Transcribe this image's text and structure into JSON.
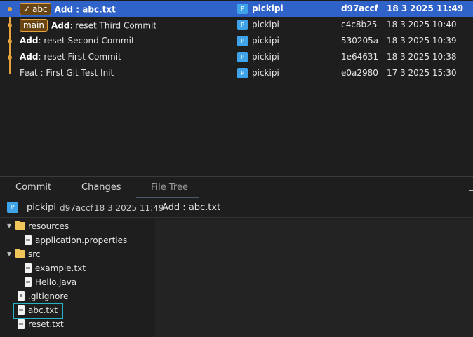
{
  "commits": [
    {
      "tag": "abc",
      "subject_kw": "Add",
      "subject_rest": " : abc.txt",
      "avatar": "P",
      "author": "pickipi",
      "hash": "d97accf",
      "date": "18 3 2025 11:49"
    },
    {
      "tag": "main",
      "subject_kw": "Add",
      "subject_rest": ": reset Third Commit",
      "avatar": "P",
      "author": "pickipi",
      "hash": "c4c8b25",
      "date": "18 3 2025 10:40"
    },
    {
      "subject_kw": "Add",
      "subject_rest": ": reset Second Commit",
      "avatar": "P",
      "author": "pickipi",
      "hash": "530205a",
      "date": "18 3 2025 10:39"
    },
    {
      "subject_kw": "Add",
      "subject_rest": ": reset First Commit",
      "avatar": "P",
      "author": "pickipi",
      "hash": "1e64631",
      "date": "18 3 2025 10:38"
    },
    {
      "subject_kw": "",
      "subject_rest": "Feat : First Git Test Init",
      "avatar": "P",
      "author": "pickipi",
      "hash": "e0a2980",
      "date": "17 3 2025 15:30"
    }
  ],
  "tabs": [
    "Commit",
    "Changes",
    "File Tree"
  ],
  "active_tab": "File Tree",
  "detail": {
    "avatar": "P",
    "author": "pickipi",
    "hash": "d97accf",
    "date": "18 3 2025 11:49",
    "message": "Add : abc.txt"
  },
  "file_tree": [
    {
      "name": "resources",
      "kind": "folder",
      "expanded": true
    },
    {
      "name": "application.properties",
      "kind": "file"
    },
    {
      "name": "src",
      "kind": "folder",
      "expanded": true
    },
    {
      "name": "example.txt",
      "kind": "file"
    },
    {
      "name": "Hello.java",
      "kind": "file"
    },
    {
      "name": ".gitignore",
      "kind": "config-file"
    },
    {
      "name": "abc.txt",
      "kind": "file",
      "selected": true
    },
    {
      "name": "reset.txt",
      "kind": "file"
    }
  ],
  "colors": {
    "accent_selection": "#2f63c9",
    "graph": "#e8a33d",
    "avatar": "#3ea3e8",
    "tree_selection_border": "#27b3c7"
  }
}
